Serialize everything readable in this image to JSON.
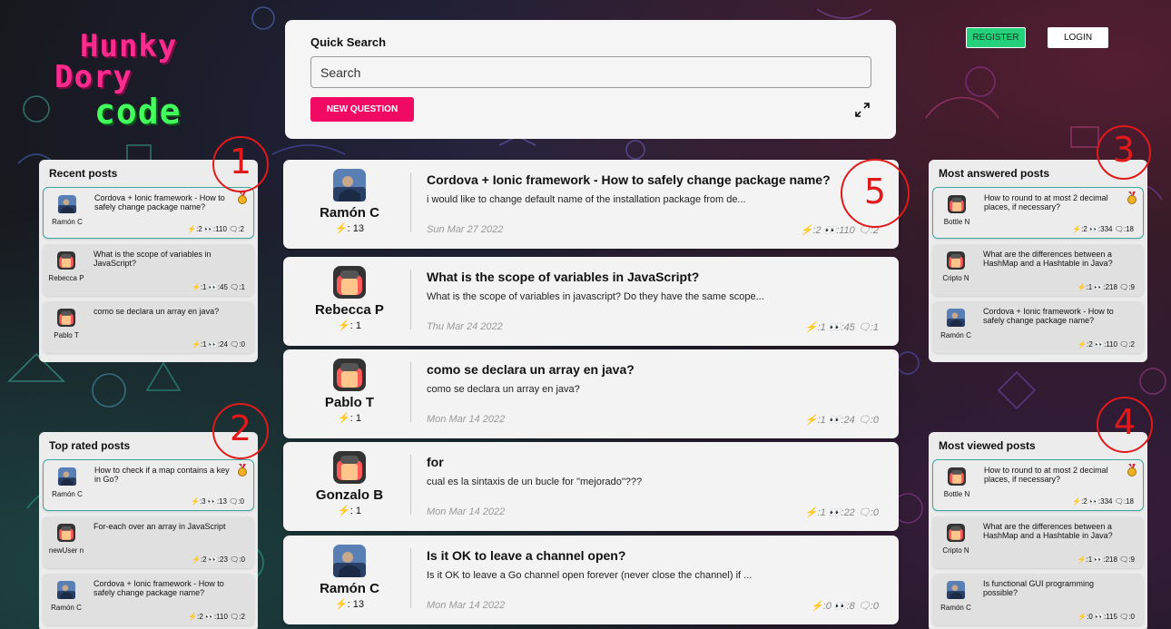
{
  "app": {
    "logo_lines": [
      "Hunky",
      "Dory",
      "code"
    ]
  },
  "header": {
    "register_label": "REGISTER",
    "login_label": "LOGIN"
  },
  "search": {
    "title": "Quick Search",
    "placeholder": "Search",
    "new_question_label": "NEW QUESTION",
    "expand_icon": "expand-icon"
  },
  "panels": {
    "recent": {
      "title": "Recent posts",
      "items": [
        {
          "author": "Ramón C",
          "title": "Cordova + Ionic framework - How to safely change package name?",
          "stats": "⚡:2 👀:110 🗨:2",
          "avatar": "photo",
          "medal": true
        },
        {
          "author": "Rebecca P",
          "title": "What is the scope of variables in JavaScript?",
          "stats": "⚡:1 👀:45 🗨:1",
          "avatar": "default",
          "medal": false
        },
        {
          "author": "Pablo T",
          "title": "como se declara un array en java?",
          "stats": "⚡:1 👀:24 🗨:0",
          "avatar": "default",
          "medal": false
        }
      ]
    },
    "top_rated": {
      "title": "Top rated posts",
      "items": [
        {
          "author": "Ramón C",
          "title": "How to check if a map contains a key in Go?",
          "stats": "⚡:3 👀:13 🗨:0",
          "avatar": "photo",
          "medal": true
        },
        {
          "author": "newUser n",
          "title": "For-each over an array in JavaScript",
          "stats": "⚡:2 👀:23 🗨:0",
          "avatar": "default",
          "medal": false
        },
        {
          "author": "Ramón C",
          "title": "Cordova + Ionic framework - How to safely change package name?",
          "stats": "⚡:2 👀:110 🗨:2",
          "avatar": "photo",
          "medal": false
        }
      ]
    },
    "most_answered": {
      "title": "Most answered posts",
      "items": [
        {
          "author": "Bottle N",
          "title": "How to round to at most 2 decimal places, if necessary?",
          "stats": "⚡:2 👀:334 🗨:18",
          "avatar": "default",
          "medal": true
        },
        {
          "author": "Cripto N",
          "title": "What are the differences between a HashMap and a Hashtable in Java?",
          "stats": "⚡:1 👀:218 🗨:9",
          "avatar": "default",
          "medal": false
        },
        {
          "author": "Ramón C",
          "title": "Cordova + Ionic framework - How to safely change package name?",
          "stats": "⚡:2 👀:110 🗨:2",
          "avatar": "photo",
          "medal": false
        }
      ]
    },
    "most_viewed": {
      "title": "Most viewed posts",
      "items": [
        {
          "author": "Bottle N",
          "title": "How to round to at most 2 decimal places, if necessary?",
          "stats": "⚡:2 👀:334 🗨:18",
          "avatar": "default",
          "medal": true
        },
        {
          "author": "Cripto N",
          "title": "What are the differences between a HashMap and a Hashtable in Java?",
          "stats": "⚡:1 👀:218 🗨:9",
          "avatar": "default",
          "medal": false
        },
        {
          "author": "Ramón C",
          "title": "Is functional GUI programming possible?",
          "stats": "⚡:0 👀:115 🗨:0",
          "avatar": "photo",
          "medal": false
        }
      ]
    }
  },
  "posts": [
    {
      "author": "Ramón C",
      "rep": "⚡: 13",
      "title": "Cordova + Ionic framework - How to safely change package name?",
      "body": "i would like to change default name of the installation package from de...",
      "date": "Sun Mar 27 2022",
      "stats": "⚡:2 👀:110 🗨:2",
      "avatar": "photo"
    },
    {
      "author": "Rebecca P",
      "rep": "⚡: 1",
      "title": "What is the scope of variables in JavaScript?",
      "body": "What is the scope of variables in javascript? Do they have the same scope...",
      "date": "Thu Mar 24 2022",
      "stats": "⚡:1 👀:45 🗨:1",
      "avatar": "default"
    },
    {
      "author": "Pablo T",
      "rep": "⚡: 1",
      "title": "como se declara un array en java?",
      "body": "como se declara un array en java?",
      "date": "Mon Mar 14 2022",
      "stats": "⚡:1 👀:24 🗨:0",
      "avatar": "default"
    },
    {
      "author": "Gonzalo B",
      "rep": "⚡: 1",
      "title": "for",
      "body": "cual es la sintaxis de un bucle for \"mejorado\"???",
      "date": "Mon Mar 14 2022",
      "stats": "⚡:1 👀:22 🗨:0",
      "avatar": "default"
    },
    {
      "author": "Ramón C",
      "rep": "⚡: 13",
      "title": "Is it OK to leave a channel open?",
      "body": "Is it OK to leave a Go channel open forever (never close the channel) if ...",
      "date": "Mon Mar 14 2022",
      "stats": "⚡:0 👀:8 🗨:0",
      "avatar": "photo"
    }
  ],
  "annotations": [
    "1",
    "2",
    "3",
    "4",
    "5"
  ],
  "colors": {
    "accent": "#f00a64",
    "register": "#25d07a",
    "highlight_border": "#3aa7a0",
    "annotation": "#e01a1a"
  }
}
